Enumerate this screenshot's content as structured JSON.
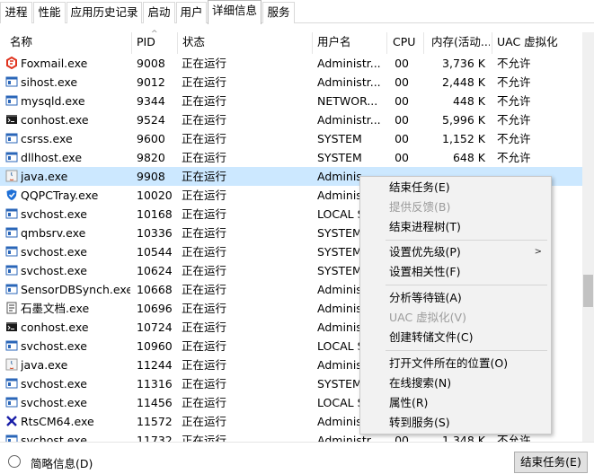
{
  "tabs": [
    "进程",
    "性能",
    "应用历史记录",
    "启动",
    "用户",
    "详细信息",
    "服务"
  ],
  "active_tab": "详细信息",
  "columns": {
    "name": "名称",
    "pid": "PID",
    "status": "状态",
    "user": "用户名",
    "cpu": "CPU",
    "memory": "内存(活动...",
    "uac": "UAC 虚拟化"
  },
  "rows": [
    {
      "name": "Foxmail.exe",
      "pid": "9008",
      "status": "正在运行",
      "user": "Administr...",
      "cpu": "00",
      "mem": "3,736 K",
      "uac": "不允许",
      "icon": "foxmail-icon"
    },
    {
      "name": "sihost.exe",
      "pid": "9012",
      "status": "正在运行",
      "user": "Administr...",
      "cpu": "00",
      "mem": "2,448 K",
      "uac": "不允许",
      "icon": "app-window-icon"
    },
    {
      "name": "mysqld.exe",
      "pid": "9344",
      "status": "正在运行",
      "user": "NETWOR...",
      "cpu": "00",
      "mem": "448 K",
      "uac": "不允许",
      "icon": "app-window-icon"
    },
    {
      "name": "conhost.exe",
      "pid": "9524",
      "status": "正在运行",
      "user": "Administr...",
      "cpu": "00",
      "mem": "5,996 K",
      "uac": "不允许",
      "icon": "console-icon"
    },
    {
      "name": "csrss.exe",
      "pid": "9600",
      "status": "正在运行",
      "user": "SYSTEM",
      "cpu": "00",
      "mem": "1,152 K",
      "uac": "不允许",
      "icon": "app-window-icon"
    },
    {
      "name": "dllhost.exe",
      "pid": "9820",
      "status": "正在运行",
      "user": "SYSTEM",
      "cpu": "00",
      "mem": "648 K",
      "uac": "不允许",
      "icon": "app-window-icon"
    },
    {
      "name": "java.exe",
      "pid": "9908",
      "status": "正在运行",
      "user": "Adminis",
      "cpu": "",
      "mem": "",
      "uac": "",
      "icon": "java-icon",
      "selected": true
    },
    {
      "name": "QQPCTray.exe",
      "pid": "10020",
      "status": "正在运行",
      "user": "Adminis",
      "cpu": "",
      "mem": "",
      "uac": "",
      "icon": "shield-icon"
    },
    {
      "name": "svchost.exe",
      "pid": "10168",
      "status": "正在运行",
      "user": "LOCAL S",
      "cpu": "",
      "mem": "",
      "uac": "",
      "icon": "app-window-icon"
    },
    {
      "name": "qmbsrv.exe",
      "pid": "10336",
      "status": "正在运行",
      "user": "SYSTEM",
      "cpu": "",
      "mem": "",
      "uac": "",
      "icon": "app-window-icon"
    },
    {
      "name": "svchost.exe",
      "pid": "10544",
      "status": "正在运行",
      "user": "SYSTEM",
      "cpu": "",
      "mem": "",
      "uac": "",
      "icon": "app-window-icon"
    },
    {
      "name": "svchost.exe",
      "pid": "10624",
      "status": "正在运行",
      "user": "SYSTEM",
      "cpu": "",
      "mem": "",
      "uac": "",
      "icon": "app-window-icon"
    },
    {
      "name": "SensorDBSynch.exe",
      "pid": "10668",
      "status": "正在运行",
      "user": "Adminis",
      "cpu": "",
      "mem": "",
      "uac": "",
      "icon": "app-window-icon"
    },
    {
      "name": "石墨文档.exe",
      "pid": "10696",
      "status": "正在运行",
      "user": "Adminis",
      "cpu": "",
      "mem": "",
      "uac": "",
      "icon": "document-app-icon"
    },
    {
      "name": "conhost.exe",
      "pid": "10724",
      "status": "正在运行",
      "user": "Adminis",
      "cpu": "",
      "mem": "",
      "uac": "",
      "icon": "console-icon"
    },
    {
      "name": "svchost.exe",
      "pid": "10960",
      "status": "正在运行",
      "user": "LOCAL S",
      "cpu": "",
      "mem": "",
      "uac": "",
      "icon": "app-window-icon"
    },
    {
      "name": "java.exe",
      "pid": "11244",
      "status": "正在运行",
      "user": "Adminis",
      "cpu": "",
      "mem": "",
      "uac": "",
      "icon": "java-icon"
    },
    {
      "name": "svchost.exe",
      "pid": "11316",
      "status": "正在运行",
      "user": "SYSTEM",
      "cpu": "",
      "mem": "",
      "uac": "",
      "icon": "app-window-icon"
    },
    {
      "name": "svchost.exe",
      "pid": "11456",
      "status": "正在运行",
      "user": "LOCAL S",
      "cpu": "",
      "mem": "",
      "uac": "",
      "icon": "app-window-icon"
    },
    {
      "name": "RtsCM64.exe",
      "pid": "11572",
      "status": "正在运行",
      "user": "Adminis",
      "cpu": "",
      "mem": "",
      "uac": "",
      "icon": "realtek-icon"
    },
    {
      "name": "svchost.exe",
      "pid": "11732",
      "status": "正在运行",
      "user": "Administr...",
      "cpu": "00",
      "mem": "1,348 K",
      "uac": "不允许",
      "icon": "app-window-icon"
    }
  ],
  "context_menu": {
    "end_task": "结束任务(E)",
    "feedback": "提供反馈(B)",
    "end_tree": "结束进程树(T)",
    "set_priority": "设置优先级(P)",
    "set_affinity": "设置相关性(F)",
    "analyze_wait": "分析等待链(A)",
    "uac_virt": "UAC 虚拟化(V)",
    "create_dump": "创建转储文件(C)",
    "open_location": "打开文件所在的位置(O)",
    "search_online": "在线搜索(N)",
    "properties": "属性(R)",
    "goto_services": "转到服务(S)"
  },
  "bottom": {
    "fewer_details": "简略信息(D)",
    "end_task": "结束任务(E)"
  },
  "colors": {
    "selected_row": "#cce8ff",
    "menu_bg": "#f2f2f2"
  }
}
